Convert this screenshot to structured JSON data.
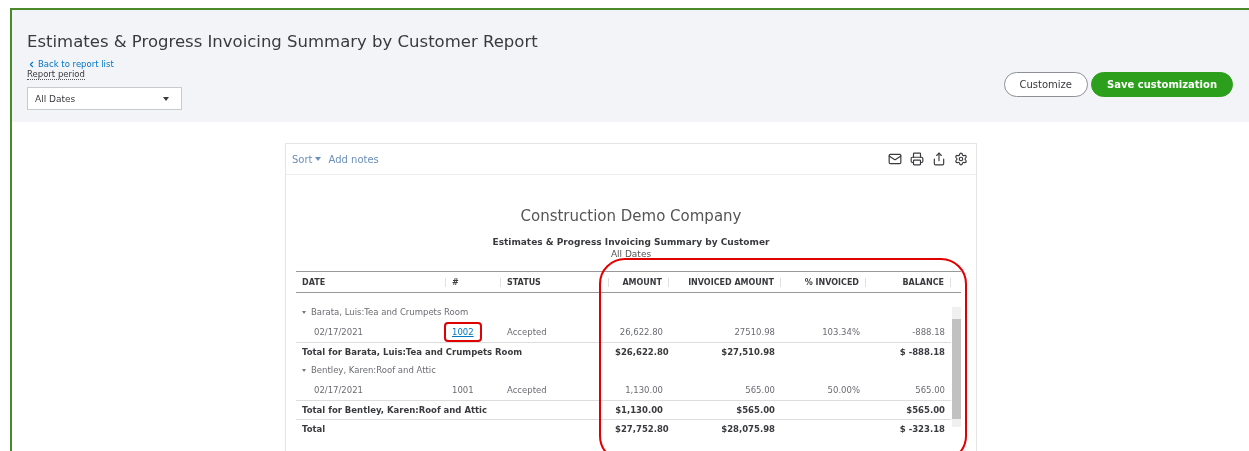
{
  "window": {
    "title": "Estimates & Progress Invoicing Summary by Customer Report"
  },
  "back_link": "Back to report list",
  "report_period": {
    "label": "Report period",
    "value": "All Dates"
  },
  "buttons": [
    {
      "label": "Customize",
      "kind": "secondary"
    },
    {
      "label": "Save customization",
      "kind": "primary"
    }
  ],
  "report": {
    "toolbar": {
      "sort": "Sort",
      "add_notes": "Add notes"
    },
    "company": "Construction Demo Company",
    "title": "Estimates & Progress Invoicing Summary by Customer",
    "period": "All Dates",
    "amount_columns_ringed": true,
    "columns": [
      "DATE",
      "#",
      "STATUS",
      "AMOUNT",
      "INVOICED AMOUNT",
      "% INVOICED",
      "BALANCE"
    ],
    "rows": [
      {
        "kind": "group",
        "label": "Barata, Luis:Tea and Crumpets Room",
        "expanded": true
      },
      {
        "kind": "detail",
        "linked": true,
        "ringed": true,
        "values": [
          "02/17/2021",
          "1002",
          "Accepted",
          "26,622.80",
          "27510.98",
          "103.34%",
          "-888.18"
        ]
      },
      {
        "kind": "subtotal",
        "label": "Total for Barata, Luis:Tea and Crumpets Room",
        "totals": {
          "amount": "$26,622.80",
          "invoiced_amount": "$27,510.98",
          "balance": "$ -888.18"
        }
      },
      {
        "kind": "group",
        "label": "Bentley, Karen:Roof and Attic",
        "expanded": true
      },
      {
        "kind": "detail",
        "linked": false,
        "ringed": false,
        "values": [
          "02/17/2021",
          "1001",
          "Accepted",
          "1,130.00",
          "565.00",
          "50.00%",
          "565.00"
        ]
      },
      {
        "kind": "subtotal",
        "label": "Total for Bentley, Karen:Roof and Attic",
        "totals": {
          "amount": "$1,130.00",
          "invoiced_amount": "$565.00",
          "balance": "$565.00"
        }
      },
      {
        "kind": "total",
        "label": "Total",
        "totals": {
          "amount": "$27,752.80",
          "invoiced_amount": "$28,075.98",
          "balance": "$ -323.18"
        }
      }
    ]
  }
}
